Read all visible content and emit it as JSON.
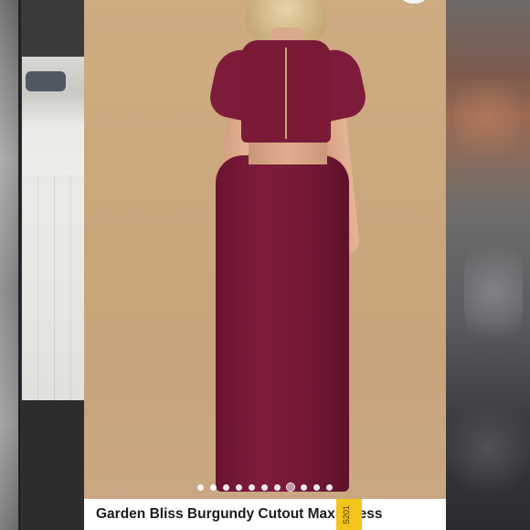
{
  "product": {
    "title": "Garden Bliss Burgundy Cutout Maxi Dress",
    "tag_text": "S201"
  },
  "carousel": {
    "dot_count": 11,
    "active_index": 7
  },
  "colors": {
    "dress": "#7a1a36",
    "background": "#cfab82",
    "tag": "#f3c41a"
  }
}
